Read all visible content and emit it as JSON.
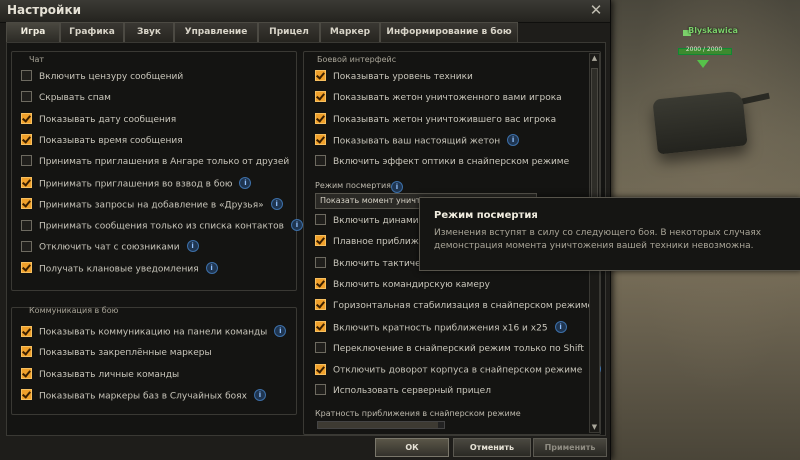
{
  "window": {
    "title": "Настройки"
  },
  "tabs": [
    "Игра",
    "Графика",
    "Звук",
    "Управление",
    "Прицел",
    "Маркер",
    "Информирование в бою"
  ],
  "chat": {
    "title": "Чат",
    "items": [
      {
        "label": "Включить цензуру сообщений",
        "checked": false,
        "info": false
      },
      {
        "label": "Скрывать спам",
        "checked": false,
        "info": false
      },
      {
        "label": "Показывать дату сообщения",
        "checked": true,
        "info": false
      },
      {
        "label": "Показывать время сообщения",
        "checked": true,
        "info": false
      },
      {
        "label": "Принимать приглашения в Ангаре только от друзей",
        "checked": false,
        "info": false
      },
      {
        "label": "Принимать приглашения во взвод в бою",
        "checked": true,
        "info": true
      },
      {
        "label": "Принимать запросы на добавление в «Друзья»",
        "checked": true,
        "info": true
      },
      {
        "label": "Принимать сообщения только из списка контактов",
        "checked": false,
        "info": true
      },
      {
        "label": "Отключить чат с союзниками",
        "checked": false,
        "info": true
      },
      {
        "label": "Получать клановые уведомления",
        "checked": true,
        "info": true
      }
    ]
  },
  "communication": {
    "title": "Коммуникация в бою",
    "items": [
      {
        "label": "Показывать коммуникацию на панели команды",
        "checked": true,
        "info": true
      },
      {
        "label": "Показывать закреплённые маркеры",
        "checked": true,
        "info": false
      },
      {
        "label": "Показывать личные команды",
        "checked": true,
        "info": false
      },
      {
        "label": "Показывать маркеры баз в Случайных боях",
        "checked": true,
        "info": true
      }
    ]
  },
  "combat": {
    "title": "Боевой интерфейс",
    "items_top": [
      {
        "label": "Показывать уровень техники",
        "checked": true,
        "info": false
      },
      {
        "label": "Показывать жетон уничтоженного вами игрока",
        "checked": true,
        "info": false
      },
      {
        "label": "Показывать жетон уничтожившего вас игрока",
        "checked": true,
        "info": false
      },
      {
        "label": "Показывать ваш настоящий жетон",
        "checked": true,
        "info": true
      },
      {
        "label": "Включить эффект оптики в снайперском режиме",
        "checked": false,
        "info": false
      }
    ],
    "postmortem_label": "Режим посмертия",
    "postmortem_value": "Показать момент уничто",
    "items_bottom": [
      {
        "label": "Включить динамическ",
        "checked": false,
        "info": false
      },
      {
        "label": "Плавное приближени",
        "checked": true,
        "info": false
      },
      {
        "label": "Включить тактически",
        "checked": false,
        "info": false
      },
      {
        "label": "Включить командирскую камеру",
        "checked": true,
        "info": false
      },
      {
        "label": "Горизонтальная стабилизация в снайперском режиме",
        "checked": true,
        "info": false
      },
      {
        "label": "Включить кратность приближения x16 и x25",
        "checked": true,
        "info": true
      },
      {
        "label": "Переключение в снайперский режим только по Shift",
        "checked": false,
        "info": false
      },
      {
        "label": "Отключить доворот корпуса в снайперском режиме",
        "checked": true,
        "info": true
      },
      {
        "label": "Использовать серверный прицел",
        "checked": false,
        "info": false
      }
    ],
    "zoom_label": "Кратность приближения в снайперском режиме"
  },
  "tooltip": {
    "title": "Режим посмертия",
    "body": "Изменения вступят в силу со следующего боя. В некоторых случаях демонстрация момента уничтожения вашей техники невозможна."
  },
  "buttons": {
    "ok": "ОК",
    "cancel": "Отменить",
    "apply": "Применить"
  },
  "game": {
    "player_name": "Blyskawica",
    "hp": "2000 / 2000"
  },
  "colors": {
    "accent": "#f0a02a",
    "info": "#8fc0ff"
  }
}
